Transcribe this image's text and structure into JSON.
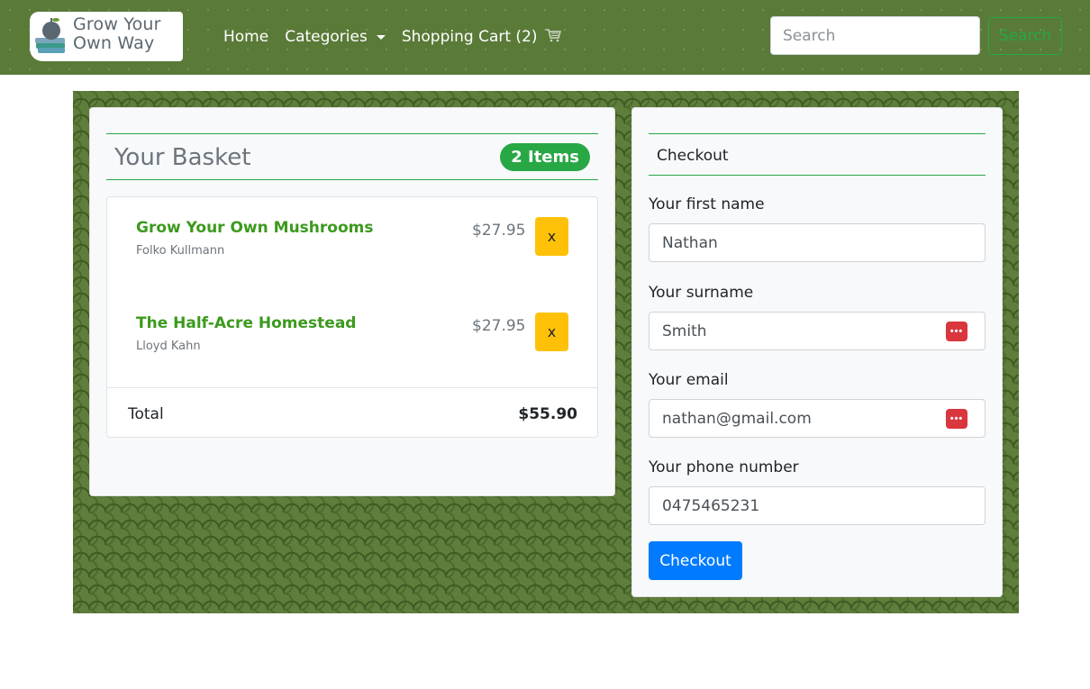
{
  "header": {
    "logo_line1": "Grow Your",
    "logo_line2": "Own Way",
    "nav": {
      "home": "Home",
      "categories": "Categories",
      "cart": "Shopping Cart (2)"
    },
    "search": {
      "placeholder": "Search",
      "button": "Search"
    }
  },
  "basket": {
    "title": "Your Basket",
    "badge": "2 Items",
    "items": [
      {
        "title": "Grow Your Own Mushrooms",
        "author": "Folko Kullmann",
        "price": "$27.95",
        "remove": "x"
      },
      {
        "title": "The Half-Acre Homestead",
        "author": "Lloyd Kahn",
        "price": "$27.95",
        "remove": "x"
      }
    ],
    "total_label": "Total",
    "total_value": "$55.90"
  },
  "checkout": {
    "title": "Checkout",
    "fields": [
      {
        "label": "Your first name",
        "value": "Nathan"
      },
      {
        "label": "Your surname",
        "value": "Smith"
      },
      {
        "label": "Your email",
        "value": "nathan@gmail.com"
      },
      {
        "label": "Your phone number",
        "value": "0475465231"
      }
    ],
    "password_manager_icon": "•••",
    "button": "Checkout"
  },
  "colors": {
    "navbar": "#5a7a38",
    "accent_green": "#28a745",
    "item_title": "#3c9a1e",
    "remove_button": "#ffc107",
    "checkout_button": "#007bff"
  }
}
